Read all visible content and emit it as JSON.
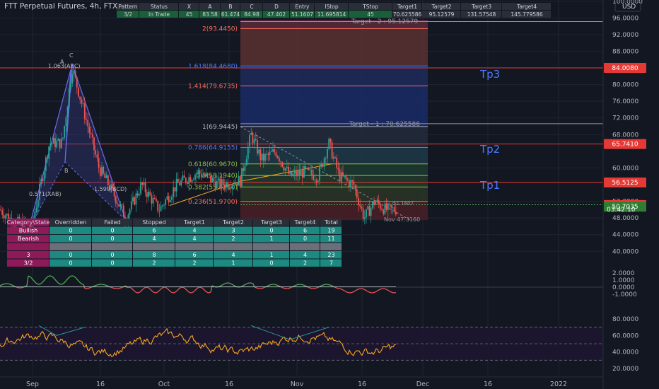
{
  "header": {
    "symbol_title": "FTT Perpetual Futures, 4h, FTX",
    "currency": "USD"
  },
  "colors": {
    "bg": "#131722",
    "grid": "#1f2433",
    "text": "#b2b5be",
    "candle_up": "#26a69a",
    "candle_down": "#ef5350",
    "hline": "#e53935",
    "fib_blue": "#4a7cff",
    "fib_red": "#ff6b5a",
    "fib_green": "#8bc34a",
    "pattern": "#6c6ce8",
    "pattern_fill": "#3a3e8c",
    "orange": "#f5a623",
    "osc_green": "#4caf50",
    "osc_red": "#ef5350",
    "table_pink": "#8e1a5a",
    "table_teal": "#1c8a80",
    "table_gray": "#6b6f7a",
    "top_table_bg": "#1b5e3a",
    "top_table_head": "#2a2e39"
  },
  "top_table": {
    "headers": [
      "Pattern",
      "Status",
      "X",
      "A",
      "B",
      "C",
      "D",
      "Entry",
      "IStop",
      "TStop",
      "Target1",
      "Target2",
      "Target3",
      "Target4"
    ],
    "row": [
      "3/2",
      "In Trade",
      "45",
      "83.58",
      "61.474",
      "84.98",
      "47.402",
      "51.1607",
      "11.695814",
      "45",
      "70.625586",
      "95.12579",
      "131.57548",
      "145.779586"
    ]
  },
  "stats_table": {
    "headers": [
      "Category\\State",
      "Overridden",
      "Failed",
      "Stopped",
      "Target1",
      "Target2",
      "Target3",
      "Target4",
      "Total"
    ],
    "rows": [
      [
        "Bullish",
        "0",
        "0",
        "6",
        "4",
        "3",
        "0",
        "6",
        "19"
      ],
      [
        "Bearish",
        "0",
        "0",
        "4",
        "4",
        "2",
        "1",
        "0",
        "11"
      ],
      [
        "",
        "",
        "",
        "",
        "",
        "",
        "",
        "",
        ""
      ],
      [
        "3",
        "0",
        "0",
        "8",
        "6",
        "4",
        "1",
        "4",
        "23"
      ],
      [
        "3/2",
        "0",
        "0",
        "2",
        "2",
        "1",
        "0",
        "2",
        "7"
      ]
    ]
  },
  "main_axis": {
    "ticks": [
      {
        "v": 100,
        "label": "100.0000"
      },
      {
        "v": 96,
        "label": "96.0000"
      },
      {
        "v": 92,
        "label": "92.0000"
      },
      {
        "v": 88,
        "label": "88.0000"
      },
      {
        "v": 80,
        "label": "80.0000"
      },
      {
        "v": 76,
        "label": "76.0000"
      },
      {
        "v": 72,
        "label": "72.0000"
      },
      {
        "v": 68,
        "label": "68.0000"
      },
      {
        "v": 60,
        "label": "60.0000"
      },
      {
        "v": 52,
        "label": "52.0000"
      },
      {
        "v": 48,
        "label": "48.0000"
      },
      {
        "v": 44,
        "label": "44.0000"
      },
      {
        "v": 40,
        "label": "40.0000"
      }
    ],
    "badges": [
      {
        "v": 84.008,
        "label": "84.0080",
        "color": "#e53935"
      },
      {
        "v": 65.741,
        "label": "65.7410",
        "color": "#e53935"
      },
      {
        "v": 56.5125,
        "label": "56.5125",
        "color": "#e53935"
      },
      {
        "v": 51.113,
        "label": "51.1130",
        "color": "#e53935"
      },
      {
        "v": 50.7035,
        "label": "50.7035",
        "color": "#2e7d32"
      }
    ],
    "countdown": "03:42:10"
  },
  "osc_axis": {
    "ticks": [
      "2.0000",
      "1.0000",
      "0.0000",
      "-1.0000"
    ]
  },
  "rsi_axis": {
    "ticks": [
      "80.0000",
      "60.0000",
      "40.0000",
      "20.0000"
    ]
  },
  "x_axis": {
    "labels": [
      "Sep",
      "16",
      "Oct",
      "16",
      "Nov",
      "16",
      "Dec",
      "16",
      "2022"
    ]
  },
  "target_labels": {
    "tp3": "Tp3",
    "tp2": "Tp2",
    "tp1": "Tp1"
  },
  "fib_levels": [
    {
      "label": "2(93.4450)",
      "v": 93.445,
      "color": "#ff6b5a"
    },
    {
      "label": "1.618(84.4680)",
      "v": 84.468,
      "color": "#4a7cff"
    },
    {
      "label": "1.414(79.6735)",
      "v": 79.6735,
      "color": "#ff6b5a"
    },
    {
      "label": "1(69.9445)",
      "v": 69.9445,
      "color": "#b2b5be"
    },
    {
      "label": "0.786(64.9155)",
      "v": 64.9155,
      "color": "#4a7cff"
    },
    {
      "label": "0.618(60.9670)",
      "v": 60.967,
      "color": "#8bc34a"
    },
    {
      "label": "0.5(58.1940)",
      "v": 58.194,
      "color": "#8bc34a"
    },
    {
      "label": "0.382(55.4210)",
      "v": 55.421,
      "color": "#8bc34a"
    },
    {
      "label": "0.236(51.9700)",
      "v": 51.97,
      "color": "#ff6b5a"
    }
  ],
  "annotations": {
    "target2": "Target - 2 : 95.12579",
    "target1": "Target - 1 : 70.625586",
    "d_label": "Nov 47.3160",
    "pt_c": "C",
    "pt_a": "A",
    "ratio_abc": "1.063(ABC)",
    "pt_b": "B",
    "ratio_xab": "0.571(XAB)",
    "ratio_bcd": "1.599(BCD)",
    "entry_tag": "51.1607"
  }
}
